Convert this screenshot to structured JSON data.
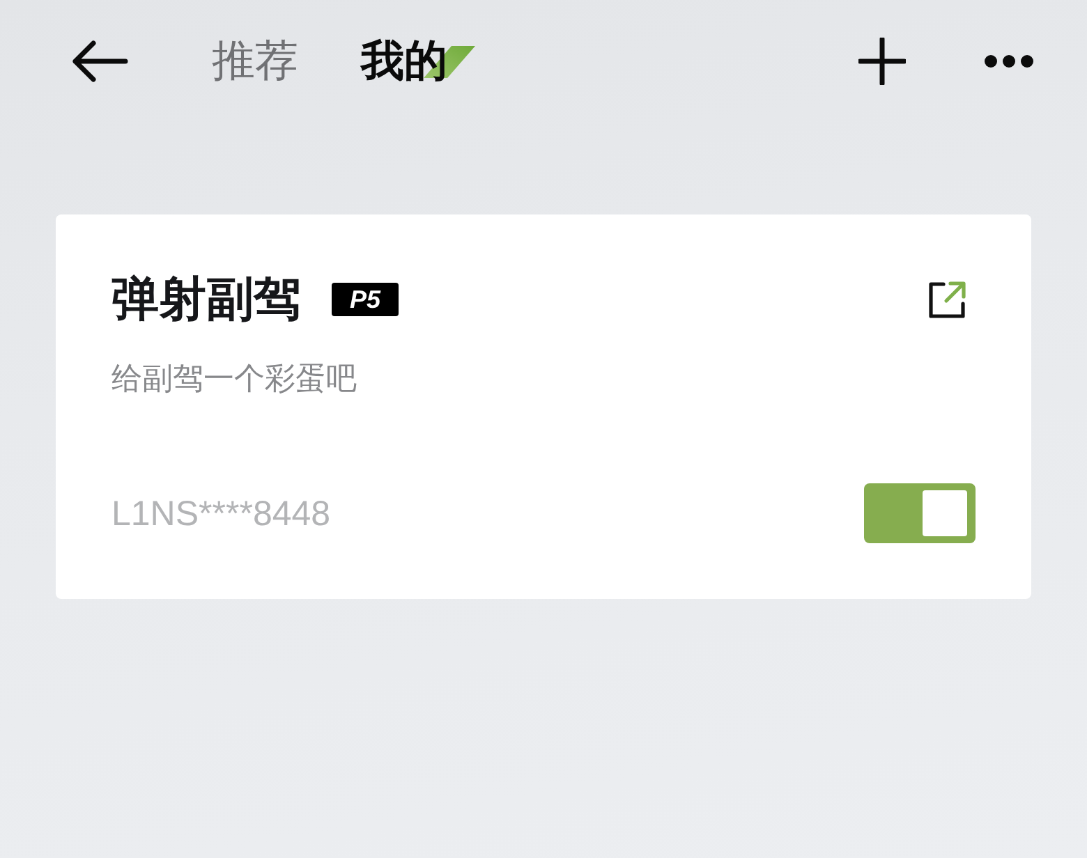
{
  "header": {
    "tabs": [
      {
        "label": "推荐",
        "selected": false
      },
      {
        "label": "我的",
        "selected": true
      }
    ]
  },
  "card": {
    "title": "弹射副驾",
    "badge": "P5",
    "subtitle": "给副驾一个彩蛋吧",
    "device_id": "L1NS****8448",
    "toggle": {
      "on": true
    }
  }
}
